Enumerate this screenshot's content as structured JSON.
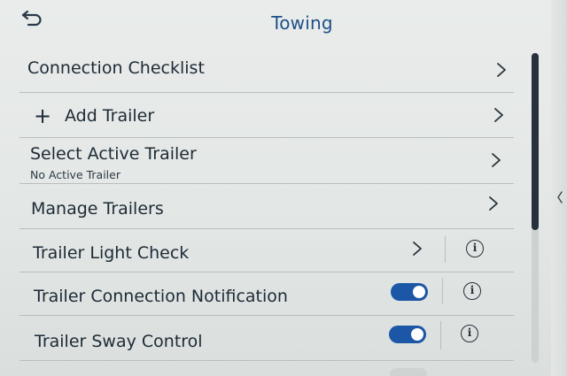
{
  "header": {
    "back_icon": "back-arrow-icon",
    "title": "Towing"
  },
  "rows": [
    {
      "label": "Connection Checklist",
      "trailing": "chevron"
    },
    {
      "label": "Add Trailer",
      "leading_icon": "plus-icon",
      "leading_glyph": "+",
      "trailing": "chevron"
    },
    {
      "label": "Select Active Trailer",
      "sublabel": "No Active Trailer",
      "trailing": "chevron"
    },
    {
      "label": "Manage Trailers",
      "trailing": "chevron"
    },
    {
      "label": "Trailer Light Check",
      "trailing": "chevron",
      "info": true,
      "info_glyph": "i"
    },
    {
      "label": "Trailer Connection Notification",
      "toggle": "on",
      "info": true,
      "info_glyph": "i"
    },
    {
      "label": "Trailer Sway Control",
      "toggle": "on",
      "info": true,
      "info_glyph": "i"
    }
  ],
  "colors": {
    "title": "#1e4f8a",
    "toggle_on": "#1c56a6",
    "text": "#1d2a36",
    "divider": "#b9bfbe"
  },
  "scrollbar": {
    "position_fraction": 0.0,
    "visible_fraction": 0.57
  }
}
